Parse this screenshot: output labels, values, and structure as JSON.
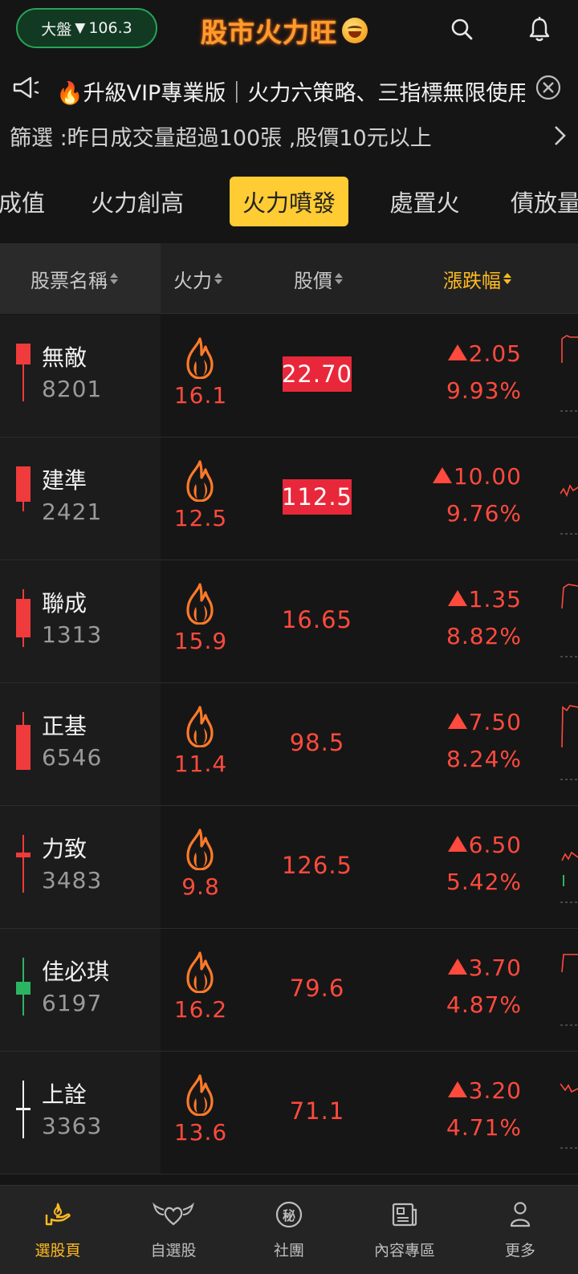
{
  "header": {
    "market_label": "大盤",
    "market_arrow": "▼",
    "market_change": "106.3",
    "brand": "股市火力旺",
    "search_icon": "search-icon",
    "bell_icon": "bell-icon"
  },
  "announcement": {
    "text": "🔥升級VIP專業版｜火力六策略、三指標無限使用",
    "icon": "megaphone-icon"
  },
  "filter": {
    "text": "篩選 :昨日成交量超過100張 ,股價10元以上"
  },
  "tabs": [
    {
      "label": "成值"
    },
    {
      "label": "火力創高"
    },
    {
      "label": "火力噴發"
    },
    {
      "label": "處置火"
    },
    {
      "label": "債放量"
    }
  ],
  "columns": {
    "name": "股票名稱",
    "fire": "火力",
    "price": "股價",
    "change": "漲跌幅"
  },
  "stocks": [
    {
      "name": "無敵",
      "code": "8201",
      "fire": "16.1",
      "price": "22.70",
      "change": "2.05",
      "pct": "9.93%",
      "candle_color": "#ef3b3b"
    },
    {
      "name": "建準",
      "code": "2421",
      "fire": "12.5",
      "price": "112.5",
      "change": "10.00",
      "pct": "9.76%",
      "candle_color": "#ef3b3b"
    },
    {
      "name": "聯成",
      "code": "1313",
      "fire": "15.9",
      "price": "16.65",
      "change": "1.35",
      "pct": "8.82%",
      "candle_color": "#ef3b3b"
    },
    {
      "name": "正基",
      "code": "6546",
      "fire": "11.4",
      "price": "98.5",
      "change": "7.50",
      "pct": "8.24%",
      "candle_color": "#ef3b3b"
    },
    {
      "name": "力致",
      "code": "3483",
      "fire": "9.8",
      "price": "126.5",
      "change": "6.50",
      "pct": "5.42%",
      "candle_color": "#ef3b3b"
    },
    {
      "name": "佳必琪",
      "code": "6197",
      "fire": "16.2",
      "price": "79.6",
      "change": "3.70",
      "pct": "4.87%",
      "candle_color": "#2bb563"
    },
    {
      "name": "上詮",
      "code": "3363",
      "fire": "13.6",
      "price": "71.1",
      "change": "3.20",
      "pct": "4.71%",
      "candle_color": "#f0f0f0"
    }
  ],
  "colors": {
    "up": "#ff4a3d",
    "accent": "#ffcc33",
    "limit_up_bg": "#e8283a"
  },
  "bottom_nav": [
    {
      "label": "選股頁",
      "icon": "hand-flame-icon"
    },
    {
      "label": "自選股",
      "icon": "winged-heart-icon"
    },
    {
      "label": "社團",
      "icon": "secret-badge-icon"
    },
    {
      "label": "內容專區",
      "icon": "newspaper-icon"
    },
    {
      "label": "更多",
      "icon": "person-icon"
    }
  ],
  "nav_secret_glyph": "秘"
}
